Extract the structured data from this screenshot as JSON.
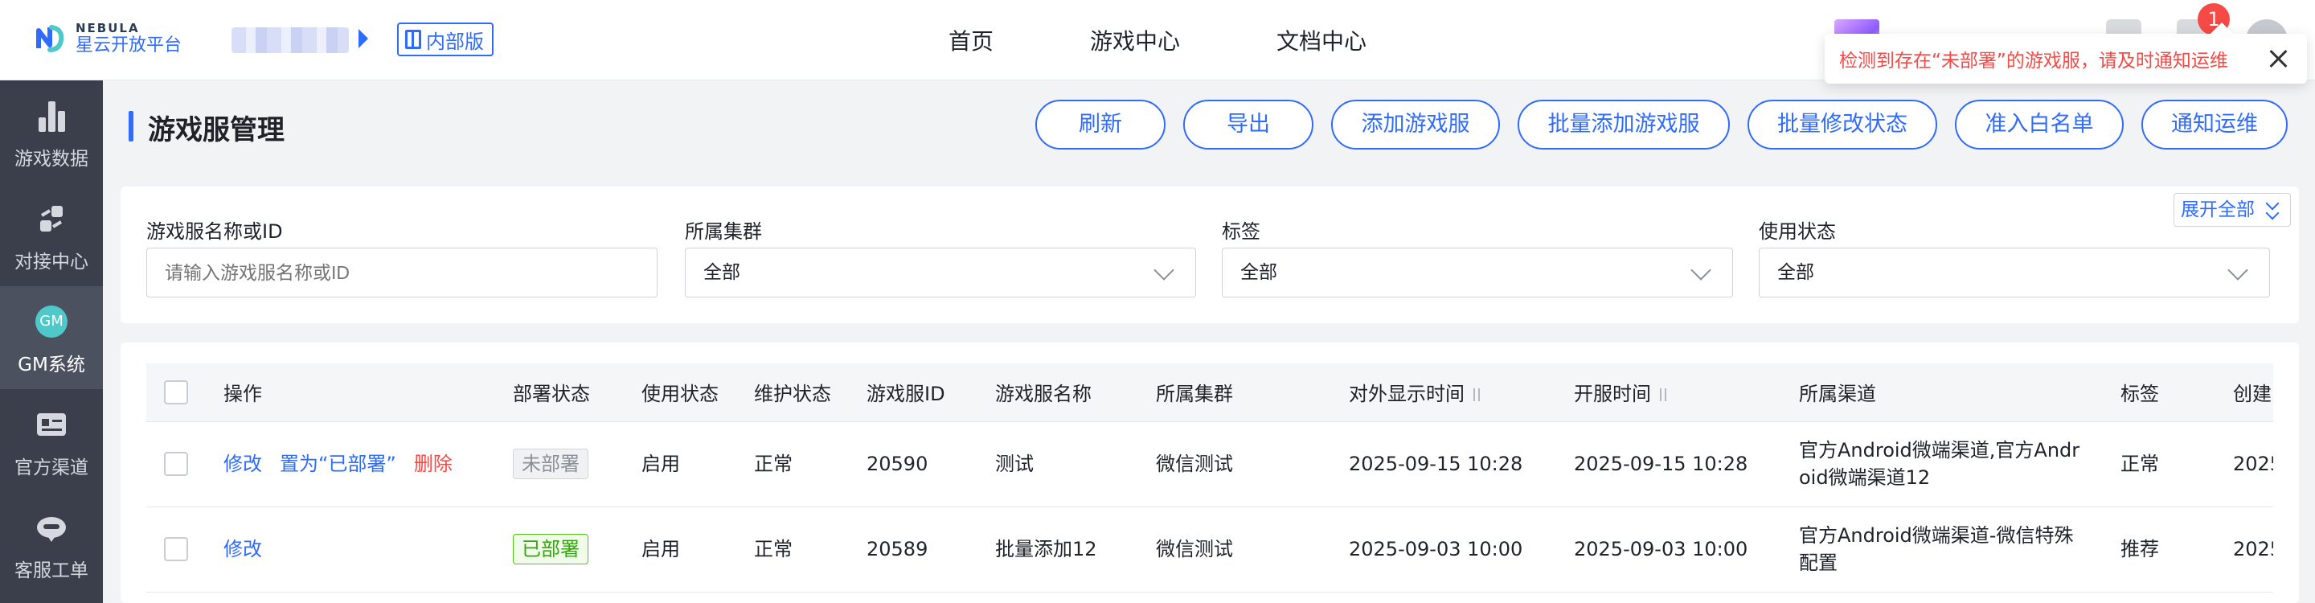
{
  "header": {
    "logo_en": "NEBULA",
    "logo_cn": "星云开放平台",
    "internal_badge": "内部版",
    "nav": [
      "首页",
      "游戏中心",
      "文档中心"
    ],
    "notification_count": "1"
  },
  "popover": {
    "message": "检测到存在“未部署”的游戏服，请及时通知运维"
  },
  "sidebar": {
    "items": [
      {
        "label": "游戏数据",
        "icon": "bar-chart-icon"
      },
      {
        "label": "对接中心",
        "icon": "link-icon"
      },
      {
        "label": "GM系统",
        "icon": "gm-icon",
        "icon_text": "GM"
      },
      {
        "label": "官方渠道",
        "icon": "id-card-icon"
      },
      {
        "label": "客服工单",
        "icon": "headset-icon"
      }
    ]
  },
  "page": {
    "title": "游戏服管理",
    "buttons": [
      "刷新",
      "导出",
      "添加游戏服",
      "批量添加游戏服",
      "批量修改状态",
      "准入白名单",
      "通知运维"
    ]
  },
  "filters": {
    "expand_label": "展开全部",
    "fields": [
      {
        "label": "游戏服名称或ID",
        "placeholder": "请输入游戏服名称或ID",
        "value": ""
      },
      {
        "label": "所属集群",
        "value": "全部"
      },
      {
        "label": "标签",
        "value": "全部"
      },
      {
        "label": "使用状态",
        "value": "全部"
      }
    ]
  },
  "table": {
    "columns": [
      "操作",
      "部署状态",
      "使用状态",
      "维护状态",
      "游戏服ID",
      "游戏服名称",
      "所属集群",
      "对外显示时间",
      "开服时间",
      "所属渠道",
      "标签",
      "创建"
    ],
    "rows": [
      {
        "actions": [
          "修改",
          "置为“已部署”",
          "删除"
        ],
        "deploy_status": "未部署",
        "use_status": "启用",
        "maint_status": "正常",
        "id": "20590",
        "name": "测试",
        "cluster": "微信测试",
        "display_time": "2025-09-15 10:28",
        "open_time": "2025-09-15 10:28",
        "channel": "官方Android微端渠道,官方Android微端渠道12",
        "tag": "正常",
        "created": "2025"
      },
      {
        "actions": [
          "修改"
        ],
        "deploy_status": "已部署",
        "use_status": "启用",
        "maint_status": "正常",
        "id": "20589",
        "name": "批量添加12",
        "cluster": "微信测试",
        "display_time": "2025-09-03 10:00",
        "open_time": "2025-09-03 10:00",
        "channel": "官方Android微端渠道-微信特殊配置",
        "tag": "推荐",
        "created": "2025"
      }
    ]
  },
  "colors": {
    "accent": "#2f6bff",
    "danger": "#f54a45",
    "success": "#52c41a",
    "sidebar_bg": "#3a3f4b"
  }
}
